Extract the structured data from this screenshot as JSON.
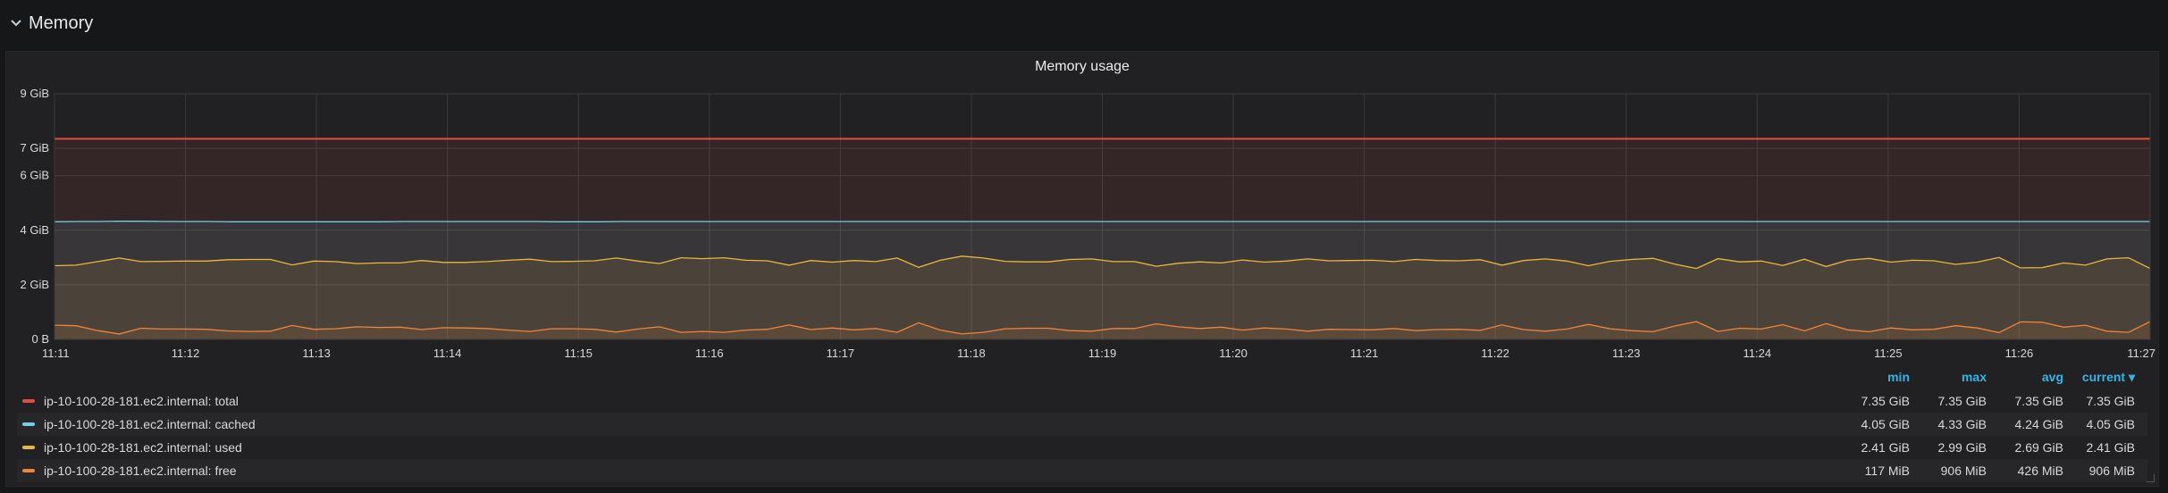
{
  "row": {
    "title": "Memory"
  },
  "panel": {
    "title": "Memory usage"
  },
  "chart_data": {
    "type": "area",
    "title": "Memory usage",
    "y_ticks": [
      "0 B",
      "2 GiB",
      "4 GiB",
      "6 GiB",
      "7 GiB",
      "9 GiB"
    ],
    "y_tick_values": [
      0,
      2,
      4,
      6,
      7,
      9
    ],
    "ylim": [
      0,
      9
    ],
    "y_unit": "GiB",
    "x_ticks": [
      "11:11",
      "11:12",
      "11:13",
      "11:14",
      "11:15",
      "11:16",
      "11:17",
      "11:18",
      "11:19",
      "11:20",
      "11:21",
      "11:22",
      "11:23",
      "11:24",
      "11:25",
      "11:26",
      "11:27"
    ],
    "xlim": [
      "11:11",
      "11:27"
    ],
    "x_points_per_minute": 6,
    "grid": true,
    "legend": "bottom",
    "series": [
      {
        "name": "ip-10-100-28-181.ec2.internal: total",
        "color": "#e24d42",
        "values": [
          7.35,
          7.35,
          7.35,
          7.35,
          7.35,
          7.35,
          7.35,
          7.35,
          7.35,
          7.35,
          7.35,
          7.35,
          7.35,
          7.35,
          7.35,
          7.35,
          7.35,
          7.35,
          7.35,
          7.35,
          7.35,
          7.35,
          7.35,
          7.35,
          7.35,
          7.35,
          7.35,
          7.35,
          7.35,
          7.35,
          7.35,
          7.35,
          7.35,
          7.35,
          7.35,
          7.35,
          7.35,
          7.35,
          7.35,
          7.35,
          7.35,
          7.35,
          7.35,
          7.35,
          7.35,
          7.35,
          7.35,
          7.35,
          7.35,
          7.35,
          7.35,
          7.35,
          7.35,
          7.35,
          7.35,
          7.35,
          7.35,
          7.35,
          7.35,
          7.35,
          7.35,
          7.35,
          7.35,
          7.35,
          7.35,
          7.35,
          7.35,
          7.35,
          7.35,
          7.35,
          7.35,
          7.35,
          7.35,
          7.35,
          7.35,
          7.35,
          7.35,
          7.35,
          7.35,
          7.35,
          7.35,
          7.35,
          7.35,
          7.35,
          7.35,
          7.35,
          7.35,
          7.35,
          7.35,
          7.35,
          7.35,
          7.35,
          7.35,
          7.35,
          7.35,
          7.35,
          7.35
        ]
      },
      {
        "name": "ip-10-100-28-181.ec2.internal: cached",
        "color": "#6ed0e0",
        "values": [
          4.31,
          4.32,
          4.32,
          4.33,
          4.33,
          4.32,
          4.32,
          4.32,
          4.31,
          4.31,
          4.31,
          4.31,
          4.31,
          4.31,
          4.31,
          4.31,
          4.32,
          4.32,
          4.32,
          4.32,
          4.32,
          4.32,
          4.32,
          4.31,
          4.31,
          4.31,
          4.32,
          4.32,
          4.32,
          4.32,
          4.32,
          4.32,
          4.32,
          4.32,
          4.32,
          4.32,
          4.32,
          4.32,
          4.32,
          4.32,
          4.32,
          4.32,
          4.32,
          4.32,
          4.32,
          4.32,
          4.32,
          4.32,
          4.32,
          4.32,
          4.32,
          4.32,
          4.32,
          4.32,
          4.32,
          4.32,
          4.32,
          4.32,
          4.32,
          4.32,
          4.32,
          4.32,
          4.32,
          4.32,
          4.32,
          4.32,
          4.32,
          4.32,
          4.32,
          4.32,
          4.32,
          4.32,
          4.32,
          4.32,
          4.32,
          4.32,
          4.32,
          4.32,
          4.32,
          4.32,
          4.32,
          4.32,
          4.32,
          4.32,
          4.32,
          4.32,
          4.32,
          4.32,
          4.32,
          4.32,
          4.32,
          4.32,
          4.32,
          4.32,
          4.32,
          4.32,
          4.32
        ]
      },
      {
        "name": "ip-10-100-28-181.ec2.internal: used",
        "color": "#eab839",
        "values": [
          2.7,
          2.72,
          2.85,
          2.98,
          2.85,
          2.86,
          2.87,
          2.87,
          2.92,
          2.93,
          2.93,
          2.73,
          2.87,
          2.85,
          2.78,
          2.8,
          2.8,
          2.89,
          2.82,
          2.82,
          2.85,
          2.9,
          2.94,
          2.85,
          2.86,
          2.88,
          2.98,
          2.87,
          2.78,
          2.99,
          2.96,
          2.99,
          2.9,
          2.88,
          2.72,
          2.89,
          2.83,
          2.89,
          2.85,
          2.98,
          2.64,
          2.9,
          3.05,
          2.98,
          2.86,
          2.84,
          2.84,
          2.93,
          2.95,
          2.85,
          2.85,
          2.68,
          2.79,
          2.84,
          2.8,
          2.91,
          2.83,
          2.87,
          2.95,
          2.88,
          2.89,
          2.9,
          2.85,
          2.93,
          2.89,
          2.88,
          2.92,
          2.72,
          2.89,
          2.95,
          2.87,
          2.7,
          2.86,
          2.93,
          2.97,
          2.76,
          2.6,
          2.96,
          2.84,
          2.87,
          2.71,
          2.94,
          2.67,
          2.9,
          2.97,
          2.83,
          2.9,
          2.88,
          2.75,
          2.83,
          3.0,
          2.62,
          2.63,
          2.8,
          2.72,
          2.95,
          2.99,
          2.6
        ]
      },
      {
        "name": "ip-10-100-28-181.ec2.internal: free",
        "color": "#ef843c",
        "values": [
          0.52,
          0.5,
          0.32,
          0.2,
          0.41,
          0.38,
          0.38,
          0.37,
          0.31,
          0.29,
          0.3,
          0.51,
          0.37,
          0.39,
          0.46,
          0.44,
          0.45,
          0.36,
          0.43,
          0.42,
          0.4,
          0.34,
          0.29,
          0.39,
          0.39,
          0.37,
          0.27,
          0.38,
          0.46,
          0.26,
          0.29,
          0.26,
          0.34,
          0.37,
          0.53,
          0.36,
          0.42,
          0.35,
          0.4,
          0.26,
          0.61,
          0.34,
          0.2,
          0.26,
          0.39,
          0.41,
          0.41,
          0.32,
          0.3,
          0.4,
          0.4,
          0.57,
          0.46,
          0.4,
          0.45,
          0.34,
          0.42,
          0.38,
          0.3,
          0.37,
          0.36,
          0.35,
          0.4,
          0.32,
          0.36,
          0.37,
          0.33,
          0.53,
          0.36,
          0.3,
          0.38,
          0.55,
          0.39,
          0.32,
          0.28,
          0.49,
          0.65,
          0.29,
          0.41,
          0.38,
          0.54,
          0.31,
          0.58,
          0.35,
          0.28,
          0.42,
          0.35,
          0.37,
          0.5,
          0.42,
          0.25,
          0.64,
          0.63,
          0.45,
          0.52,
          0.3,
          0.26,
          0.65
        ]
      }
    ]
  },
  "legend": {
    "headers": {
      "min": "min",
      "max": "max",
      "avg": "avg",
      "current": "current ▾"
    },
    "rows": [
      {
        "name": "ip-10-100-28-181.ec2.internal: total",
        "color": "#e24d42",
        "min": "7.35 GiB",
        "max": "7.35 GiB",
        "avg": "7.35 GiB",
        "current": "7.35 GiB"
      },
      {
        "name": "ip-10-100-28-181.ec2.internal: cached",
        "color": "#6ed0e0",
        "min": "4.05 GiB",
        "max": "4.33 GiB",
        "avg": "4.24 GiB",
        "current": "4.05 GiB"
      },
      {
        "name": "ip-10-100-28-181.ec2.internal: used",
        "color": "#eab839",
        "min": "2.41 GiB",
        "max": "2.99 GiB",
        "avg": "2.69 GiB",
        "current": "2.41 GiB"
      },
      {
        "name": "ip-10-100-28-181.ec2.internal: free",
        "color": "#ef843c",
        "min": "117 MiB",
        "max": "906 MiB",
        "avg": "426 MiB",
        "current": "906 MiB"
      }
    ]
  }
}
